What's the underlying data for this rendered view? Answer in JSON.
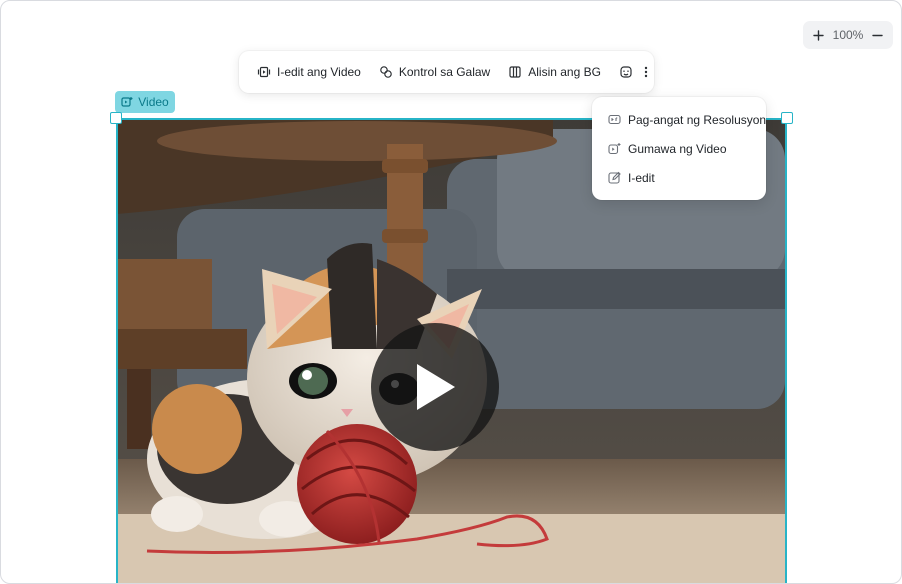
{
  "zoom": {
    "plus": "+",
    "level": "100%",
    "minus": "−"
  },
  "toolbar": {
    "edit_video": "I-edit ang Video",
    "motion_control": "Kontrol sa Galaw",
    "remove_bg": "Alisin ang BG"
  },
  "chip": {
    "label": "Video"
  },
  "menu": {
    "items": [
      {
        "label": "Pag-angat ng Resolusyon",
        "icon": "upscale-icon"
      },
      {
        "label": "Gumawa ng Video",
        "icon": "generate-video-icon"
      },
      {
        "label": "I-edit",
        "icon": "edit-icon"
      }
    ]
  },
  "colors": {
    "accent": "#27b4c7",
    "chip_bg": "#7fd6e2",
    "chip_text": "#0b7a8a"
  }
}
